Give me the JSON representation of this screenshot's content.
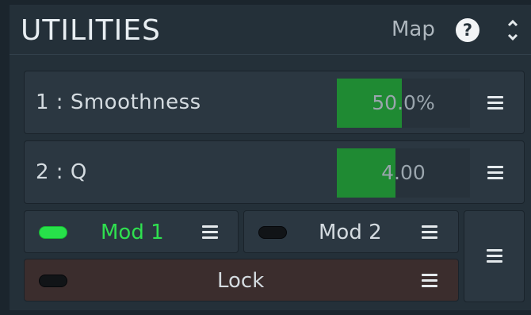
{
  "header": {
    "title": "UTILITIES",
    "map_label": "Map",
    "help_symbol": "?"
  },
  "rows": [
    {
      "label": "1 : Smoothness",
      "value_text": "50.0%",
      "fill_fraction": 0.49
    },
    {
      "label": "2 : Q",
      "value_text": "4.00",
      "fill_fraction": 0.44
    }
  ],
  "mods": [
    {
      "label": "Mod 1",
      "active": true
    },
    {
      "label": "Mod 2",
      "active": false
    }
  ],
  "lock": {
    "label": "Lock",
    "active": false
  },
  "colors": {
    "accent_green": "#1f8a33",
    "led_on": "#27e14a",
    "active_text": "#2fe04f",
    "lock_background": "#3b2d2d"
  },
  "icons": {
    "help": "help-icon",
    "expand": "expand-collapse-icon",
    "menu": "hamburger-menu-icon"
  }
}
